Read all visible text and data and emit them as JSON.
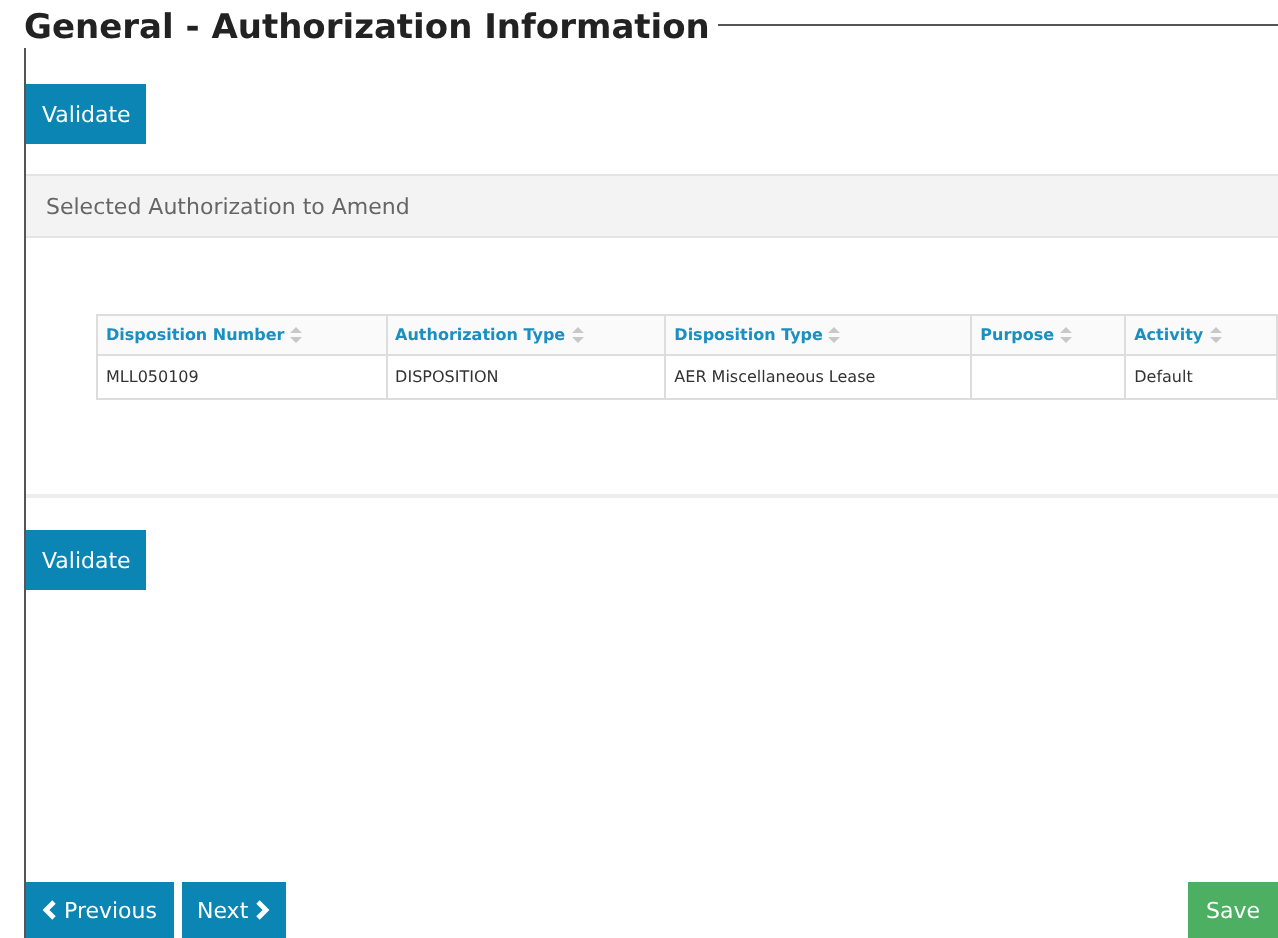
{
  "title": "General - Authorization Information",
  "validate_top": "Validate",
  "panel": {
    "heading": "Selected Authorization to Amend"
  },
  "table": {
    "columns": [
      "Disposition Number",
      "Authorization Type",
      "Disposition Type",
      "Purpose",
      "Activity"
    ],
    "rows": [
      [
        "MLL050109",
        "DISPOSITION",
        "AER Miscellaneous Lease",
        "",
        "Default"
      ]
    ]
  },
  "validate_bottom": "Validate",
  "footer": {
    "previous": "Previous",
    "next": "Next",
    "save": "Save"
  }
}
